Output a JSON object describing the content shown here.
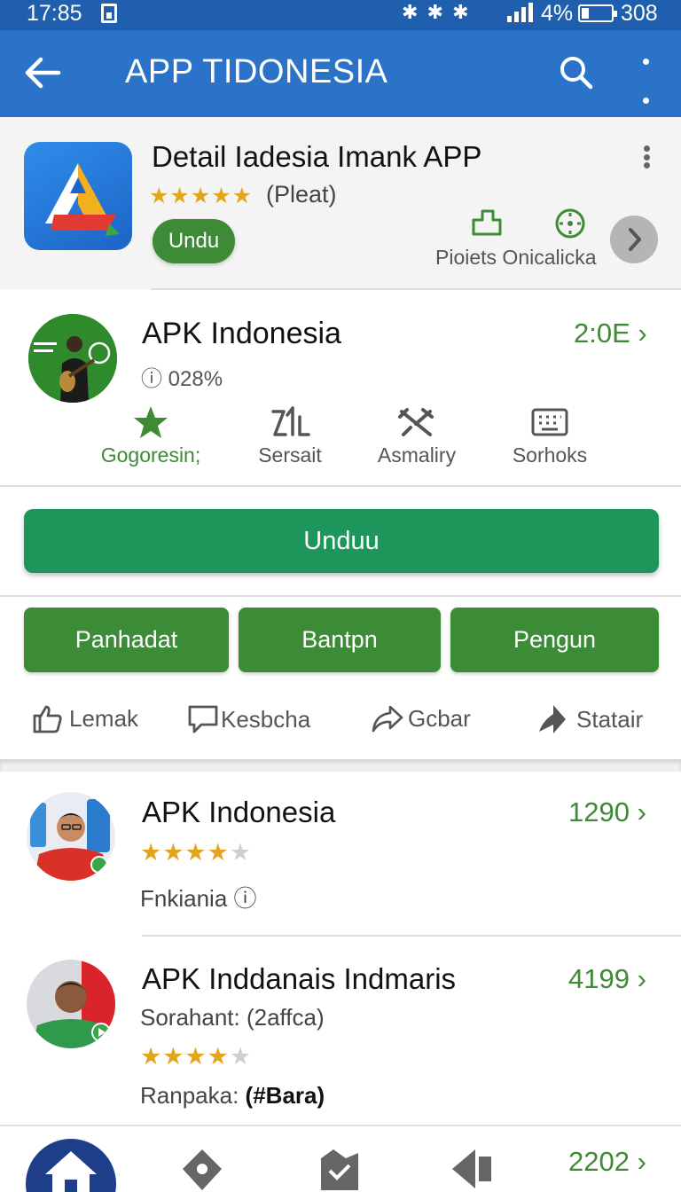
{
  "status_bar": {
    "time": "17:85",
    "icons": "✱ ✱ ✱",
    "battery_pct": "4%",
    "extra": "308"
  },
  "app_bar": {
    "title": "APP TIDONESIA"
  },
  "header": {
    "title": "Detail Iadesia Imank APP",
    "stars": "★★★★★",
    "rating_label": "(Pleat)",
    "button_label": "Undu",
    "actions_label": "Pioiets Onicalicka"
  },
  "featured": {
    "name": "APK Indonesia",
    "info": "ⓘ 028%",
    "price": "2:0E",
    "stats": [
      {
        "icon": "star-icon",
        "label": "Gogoresin;"
      },
      {
        "icon": "sort-icon",
        "label": "Sersait"
      },
      {
        "icon": "tools-icon",
        "label": "Asmaliry"
      },
      {
        "icon": "keyboard-icon",
        "label": "Sorhoks"
      }
    ],
    "download_label": "Unduu",
    "tabs": [
      "Panhadat",
      "Bantpn",
      "Pengun"
    ],
    "social": [
      "Lemak",
      "Kesbcha",
      "Gcbar",
      "Statair"
    ]
  },
  "list": [
    {
      "name": "APK Indonesia",
      "price": "1290",
      "stars_on": "★★★★",
      "stars_off": "★",
      "sub": "Fnkiania ⓘ"
    },
    {
      "name": "APK Inddanais Indmaris",
      "price": "4199",
      "detail": "Sorahant: (2affca)",
      "stars_on": "★★★★",
      "stars_off": "★",
      "sub_prefix": "Ranpaka:",
      "sub_bold": "(#Bara)"
    }
  ],
  "bottom_nav": {
    "price": "2202"
  },
  "colors": {
    "primary": "#2a73c9",
    "status": "#1f5fae",
    "green": "#3b8b37",
    "download": "#1e955a",
    "price": "#3e8a35",
    "star": "#e3a51c"
  }
}
